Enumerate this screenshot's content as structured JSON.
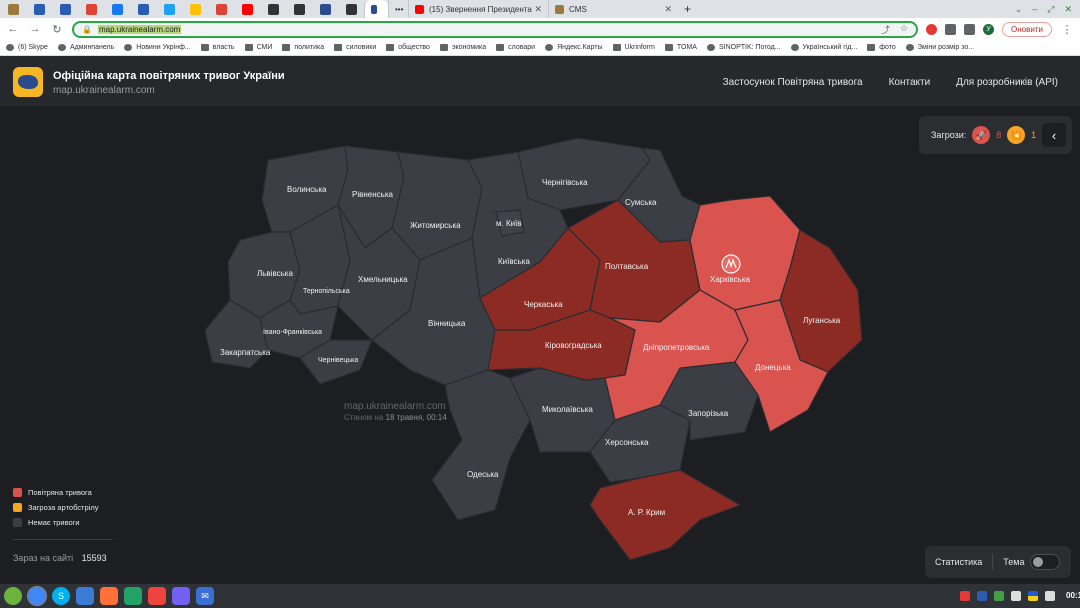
{
  "browser": {
    "tabs": [
      {
        "title": "(15) Звернення Президента",
        "color": "#ff0000"
      },
      {
        "title": "CMS",
        "color": "#9c7a3c"
      }
    ],
    "pinned_tab_colors": [
      "#9c7a3c",
      "#2a5db0",
      "#2a5db0",
      "#db4437",
      "#1877f2",
      "#2a5db0",
      "#1da1f2",
      "#ffc107",
      "#db4437",
      "#ff0000",
      "#333333",
      "#333333",
      "#2a4c8c",
      "#333333"
    ],
    "url": "map.ukrainealarm.com",
    "update_label": "Оновити",
    "profile_initial": "У",
    "bookmarks": [
      {
        "label": "(6) Skype",
        "icon": "skype-icon"
      },
      {
        "label": "Админпанель",
        "icon": "admin-icon"
      },
      {
        "label": "Новини Укрінф...",
        "icon": "news-icon"
      },
      {
        "label": "влаcть",
        "icon": "folder-icon"
      },
      {
        "label": "СМИ",
        "icon": "folder-icon"
      },
      {
        "label": "политика",
        "icon": "folder-icon"
      },
      {
        "label": "силовики",
        "icon": "folder-icon"
      },
      {
        "label": "общество",
        "icon": "folder-icon"
      },
      {
        "label": "экономика",
        "icon": "folder-icon"
      },
      {
        "label": "словари",
        "icon": "folder-icon"
      },
      {
        "label": "Яндекс.Карты",
        "icon": "yandex-icon"
      },
      {
        "label": "Ukrinform",
        "icon": "folder-icon"
      },
      {
        "label": "TOMA",
        "icon": "folder-icon"
      },
      {
        "label": "SINOPTIK: Погод...",
        "icon": "sinoptik-icon"
      },
      {
        "label": "Український гід...",
        "icon": "guide-icon"
      },
      {
        "label": "фото",
        "icon": "folder-icon"
      },
      {
        "label": "Зміни розмір зо...",
        "icon": "resize-icon"
      }
    ]
  },
  "site": {
    "title": "Офіційна карта повітряних тривог України",
    "subtitle": "map.ukrainealarm.com",
    "nav": [
      "Застосунок Повітряна тривога",
      "Контакти",
      "Для розробників (API)"
    ]
  },
  "threats": {
    "label": "Загрози:",
    "air_count": "8",
    "artillery_count": "1"
  },
  "map": {
    "watermark": "map.ukrainealarm.com",
    "as_of_prefix": "Станом на",
    "as_of_value": "18 травня, 00:14",
    "colors": {
      "alarm": "#d9534f",
      "alarm_dark": "#8c2a24",
      "none": "#3b3e45"
    },
    "regions": [
      {
        "name": "Волинська",
        "status": "none"
      },
      {
        "name": "Рівненська",
        "status": "none"
      },
      {
        "name": "Житомирська",
        "status": "none"
      },
      {
        "name": "м. Київ",
        "status": "none"
      },
      {
        "name": "Київська",
        "status": "none"
      },
      {
        "name": "Чернігівська",
        "status": "none"
      },
      {
        "name": "Сумська",
        "status": "none"
      },
      {
        "name": "Львівська",
        "status": "none"
      },
      {
        "name": "Тернопільська",
        "status": "none"
      },
      {
        "name": "Хмельницька",
        "status": "none"
      },
      {
        "name": "Івано-Франківська",
        "status": "none"
      },
      {
        "name": "Закарпатська",
        "status": "none"
      },
      {
        "name": "Чернівецька",
        "status": "none"
      },
      {
        "name": "Вінницька",
        "status": "none"
      },
      {
        "name": "Черкаська",
        "status": "alarm"
      },
      {
        "name": "Полтавська",
        "status": "alarm"
      },
      {
        "name": "Кіровоградська",
        "status": "alarm"
      },
      {
        "name": "Харківська",
        "status": "alarm"
      },
      {
        "name": "Луганська",
        "status": "alarm"
      },
      {
        "name": "Дніпропетровська",
        "status": "alarm"
      },
      {
        "name": "Донецька",
        "status": "alarm"
      },
      {
        "name": "Миколаївська",
        "status": "none"
      },
      {
        "name": "Запорізька",
        "status": "none"
      },
      {
        "name": "Херсонська",
        "status": "none"
      },
      {
        "name": "Одеська",
        "status": "none"
      },
      {
        "name": "А. Р. Крим",
        "status": "alarm"
      }
    ]
  },
  "legend": [
    {
      "label": "Повітряна тривога",
      "color": "#d9534f"
    },
    {
      "label": "Загроза артобстрілу",
      "color": "#f5a623"
    },
    {
      "label": "Немає тривоги",
      "color": "#3b3e45"
    }
  ],
  "online": {
    "label": "Зараз на сайті",
    "count": "15593"
  },
  "footer": {
    "stats": "Статистика",
    "theme": "Тема"
  },
  "taskbar": {
    "apps": [
      "mint-menu-icon",
      "chrome-icon",
      "skype-icon",
      "files-icon",
      "firefox-icon",
      "spreadsheet-icon",
      "anydesk-icon",
      "viber-icon",
      "mail-icon"
    ],
    "clock": "00:14"
  }
}
